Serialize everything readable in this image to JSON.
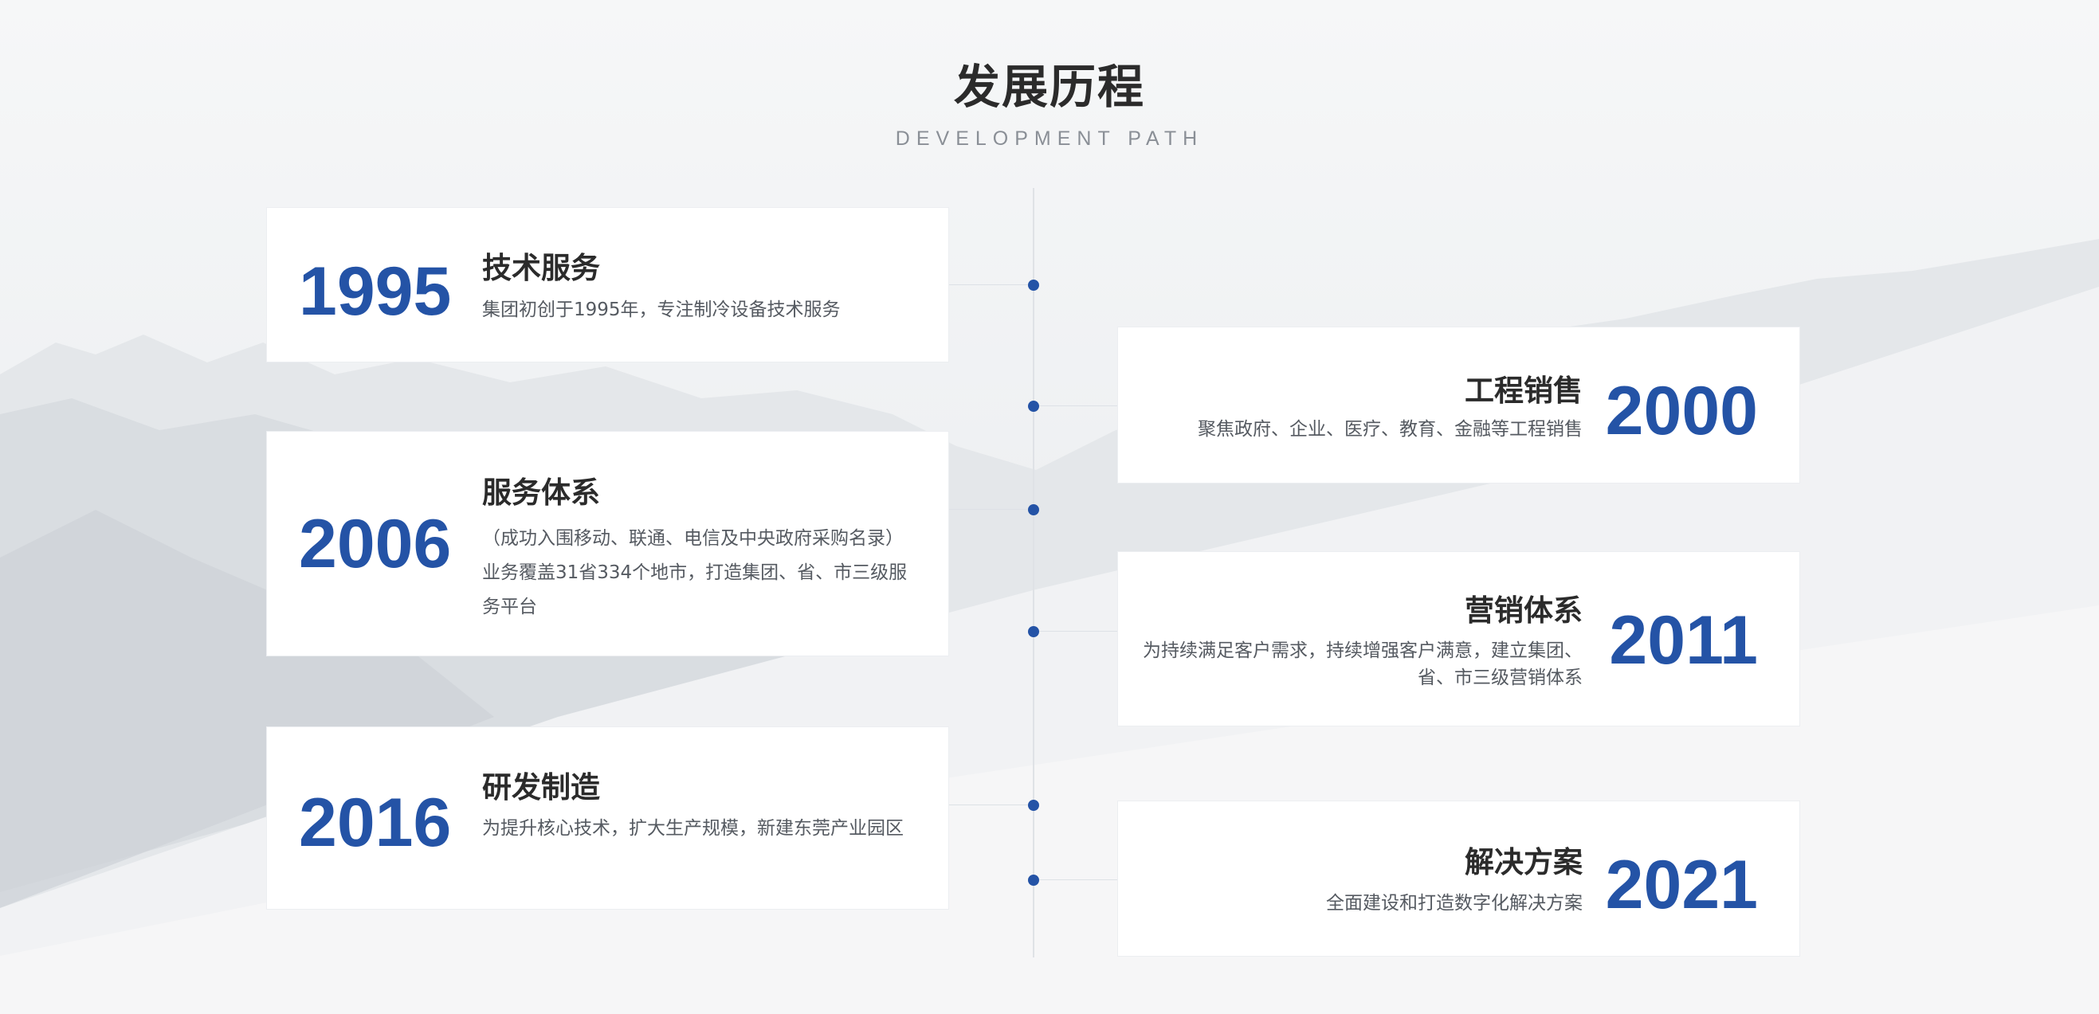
{
  "header": {
    "title": "发展历程",
    "subtitle": "DEVELOPMENT PATH"
  },
  "colors": {
    "accent": "#2453a6",
    "title_text": "#2b2b2b",
    "body_text": "#555a61",
    "subtitle_text": "#8a8f96",
    "card_background": "#ffffff"
  },
  "timeline": {
    "items": [
      {
        "year": "1995",
        "title": "技术服务",
        "description": "集团初创于1995年，专注制冷设备技术服务"
      },
      {
        "year": "2000",
        "title": "工程销售",
        "description": "聚焦政府、企业、医疗、教育、金融等工程销售"
      },
      {
        "year": "2006",
        "title": "服务体系",
        "description": "（成功入围移动、联通、电信及中央政府采购名录）业务覆盖31省334个地市，打造集团、省、市三级服务平台"
      },
      {
        "year": "2011",
        "title": "营销体系",
        "description": "为持续满足客户需求，持续增强客户满意，建立集团、省、市三级营销体系"
      },
      {
        "year": "2016",
        "title": "研发制造",
        "description": "为提升核心技术，扩大生产规模，新建东莞产业园区"
      },
      {
        "year": "2021",
        "title": "解决方案",
        "description": "全面建设和打造数字化解决方案"
      }
    ]
  }
}
